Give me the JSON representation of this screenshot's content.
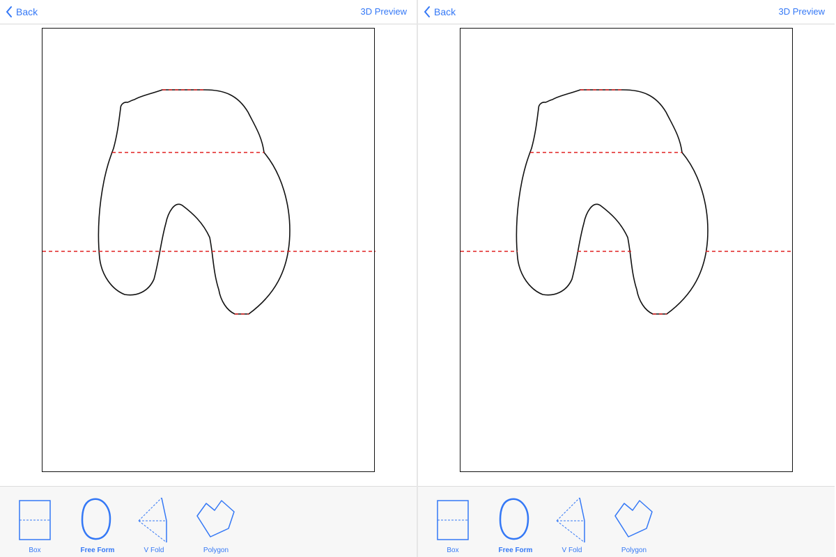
{
  "nav": {
    "back_label": "Back",
    "preview_label": "3D Preview"
  },
  "tools": [
    {
      "label": "Box",
      "icon": "box-icon",
      "active": false
    },
    {
      "label": "Free Form",
      "icon": "free-form-icon",
      "active": true
    },
    {
      "label": "V Fold",
      "icon": "v-fold-icon",
      "active": false
    },
    {
      "label": "Polygon",
      "icon": "polygon-icon",
      "active": false
    }
  ],
  "colors": {
    "accent": "#3478f6",
    "cut_line": "#111111",
    "fold_line": "#e02020"
  }
}
